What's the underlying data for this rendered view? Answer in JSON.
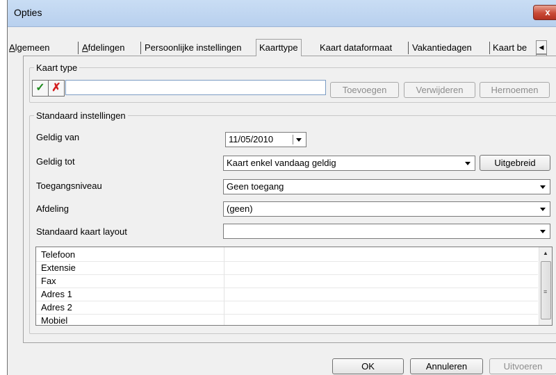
{
  "window": {
    "title": "Opties",
    "close_label": "x"
  },
  "tabs": {
    "items": [
      "Algemeen",
      "Afdelingen",
      "Persoonlijke instellingen",
      "Kaarttype",
      "Kaart dataformaat",
      "Vakantiedagen",
      "Kaart be"
    ],
    "active": "Kaarttype",
    "scroll_left": "◀",
    "scroll_right": "▶"
  },
  "kaart_type": {
    "legend": "Kaart type",
    "confirm_icon": "✓",
    "cancel_icon": "✗",
    "input_value": "",
    "add_label": "Toevoegen",
    "remove_label": "Verwijderen",
    "rename_label": "Hernoemen"
  },
  "standaard": {
    "legend": "Standaard instellingen",
    "geldig_van_label": "Geldig van",
    "geldig_van_value": "11/05/2010",
    "geldig_tot_label": "Geldig tot",
    "geldig_tot_value": "Kaart enkel vandaag geldig",
    "uitgebreid_label": "Uitgebreid",
    "toegang_label": "Toegangsniveau",
    "toegang_value": "Geen toegang",
    "afdeling_label": "Afdeling",
    "afdeling_value": "(geen)",
    "layout_label": "Standaard kaart layout",
    "layout_value": ""
  },
  "fields_list": {
    "items": [
      "Telefoon",
      "Extensie",
      "Fax",
      "Adres 1",
      "Adres 2",
      "Mobiel"
    ]
  },
  "footer": {
    "ok_label": "OK",
    "cancel_label": "Annuleren",
    "apply_label": "Uitvoeren"
  },
  "colors": {
    "titlebar": "#c9ddf4",
    "close": "#c94a36",
    "ok_green": "#1e8a1e",
    "cancel_red": "#d42020"
  }
}
